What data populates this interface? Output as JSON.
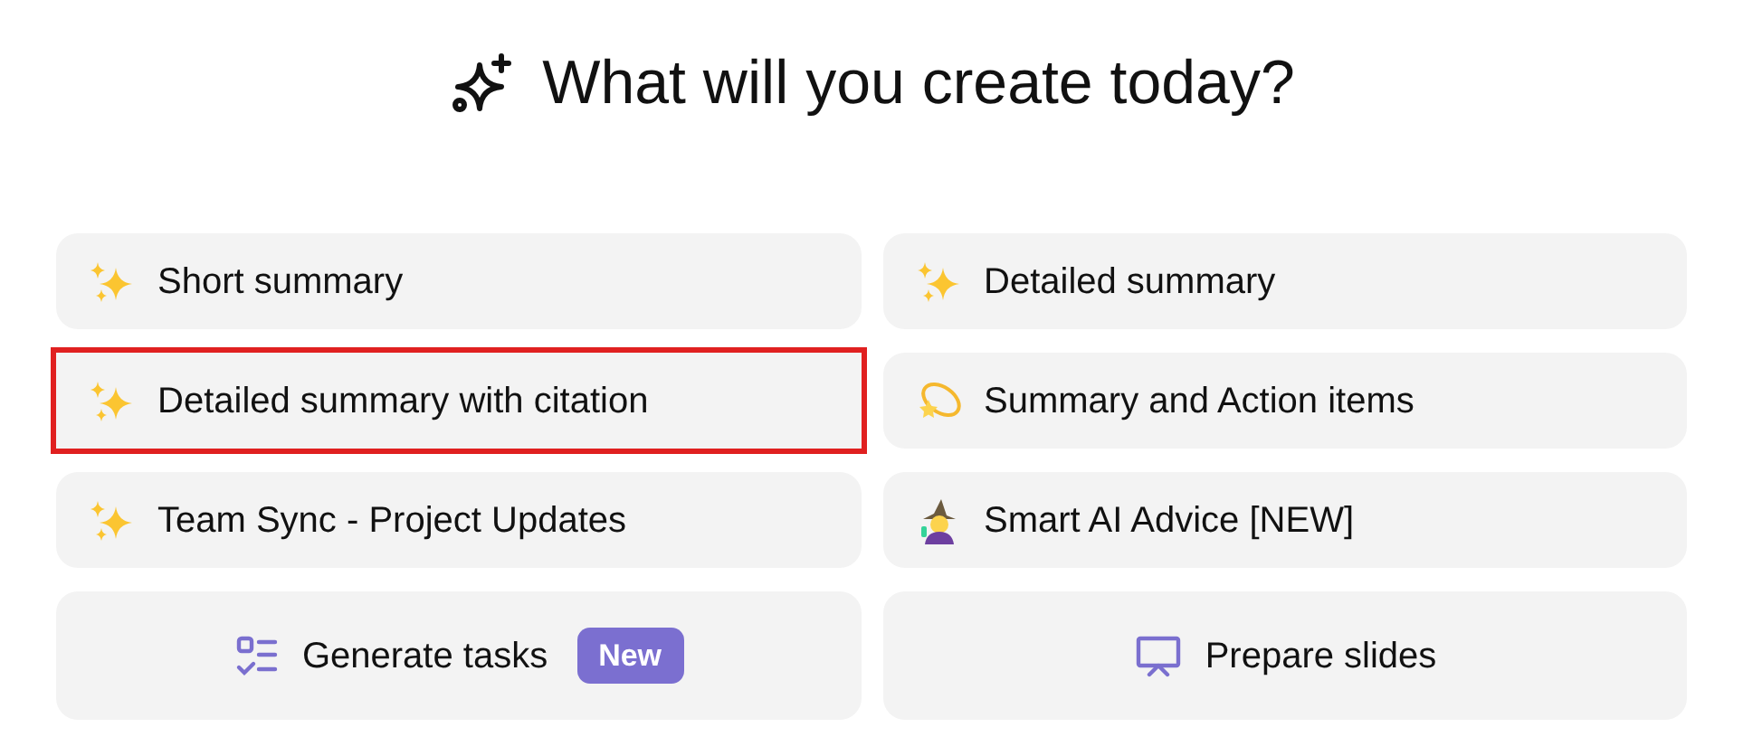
{
  "title": "What will you create today?",
  "templates": [
    {
      "label": "Short summary",
      "kind": "sparkles",
      "highlighted": false
    },
    {
      "label": "Detailed summary",
      "kind": "sparkles",
      "highlighted": false
    },
    {
      "label": "Detailed summary with citation",
      "kind": "sparkles",
      "highlighted": true
    },
    {
      "label": "Summary and Action items",
      "kind": "dizzy",
      "highlighted": false
    },
    {
      "label": "Team Sync - Project Updates",
      "kind": "sparkles",
      "highlighted": false
    },
    {
      "label": "Smart AI Advice [NEW]",
      "kind": "wizard",
      "highlighted": false
    }
  ],
  "actions": [
    {
      "label": "Generate tasks",
      "kind": "tasks",
      "badge": "New"
    },
    {
      "label": "Prepare slides",
      "kind": "slides"
    }
  ]
}
